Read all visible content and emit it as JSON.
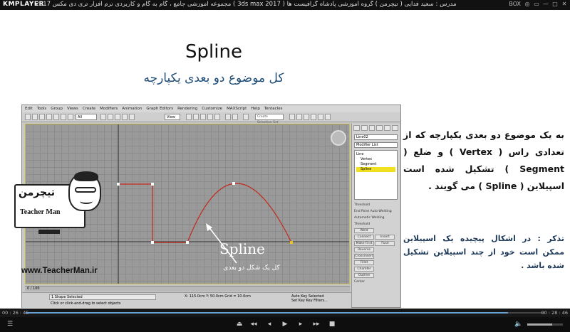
{
  "player": {
    "logo": "KMPLAYER",
    "title": "مجموعه آموزشی جامع ، گام به گام و کاربردی نرم افزار تری دی مکس 2017 ( 3ds max 2017 ) مدرس : سعید فدایی ( تیچرمن ) گروه آموزشی پادشاه گرافیست ها",
    "controls": [
      "BOX",
      "◎",
      "▭",
      "—",
      "□",
      "✕"
    ],
    "time_elapsed": "00 : 26 : 45",
    "time_total": "00 : 28 : 46",
    "progress": 0.93,
    "volume": 0.7,
    "buttons": [
      "⏏",
      "◂◂",
      "◂",
      "▶",
      "▸",
      "▸▸",
      "■"
    ]
  },
  "slide": {
    "title": "Spline",
    "subtitle": "کل موضوع دو بعدی یکپارچه",
    "explanation": "به یک موضوع دو بعدی یکپارچه که از تعدادی راس ( Vertex ) و ضلع ( Segment ) تشکیل شده است اسپیلاین ( Spline ) می گویند .",
    "note": "تذکر : در اشکال پیچیده یک اسپیلاین ممکن است خود از چند اسپیلاین تشکیل شده باشد .",
    "viewport_label": "Spline",
    "viewport_sublabel": "کل یک شکل دو بعدی",
    "website": "www.TeacherMan.ir"
  },
  "logo": {
    "fa": "تیچرمن",
    "en": "Teacher Man"
  },
  "max": {
    "menu": [
      "Edit",
      "Tools",
      "Group",
      "Views",
      "Create",
      "Modifiers",
      "Animation",
      "Graph Editors",
      "Rendering",
      "Customize",
      "MAXScript",
      "Help",
      "Tentacles"
    ],
    "toolbar_select": "All",
    "toolbar_view": "View",
    "selection_set": "Create Selection Set",
    "object_name": "Line02",
    "modifier_list": "Modifier List",
    "stack": [
      "Line",
      "Vertex",
      "Segment",
      "Spline"
    ],
    "stack_active_index": 3,
    "rollout": [
      "Threshold",
      "End Point Auto-Welding",
      "Automatic Welding",
      "Threshold",
      "Weld",
      "Connect",
      "Insert",
      "Make First",
      "Fuse",
      "Reverse",
      "Crossinsert",
      "Fillet",
      "Chamfer",
      "Outline",
      "Center"
    ],
    "timeline": "0 / 100",
    "status_selected": "1 Shape Selected",
    "status_hint": "Click or click-and-drag to select objects",
    "coord_x": "115.0cm",
    "coord_y": "50.0cm",
    "grid": "Grid = 10.0cm",
    "auto_key": "Auto Key",
    "set_key": "Set Key",
    "key_selected": "Selected",
    "add_time_tag": "Add Time Tag",
    "key_filters": "Key Filters..."
  }
}
